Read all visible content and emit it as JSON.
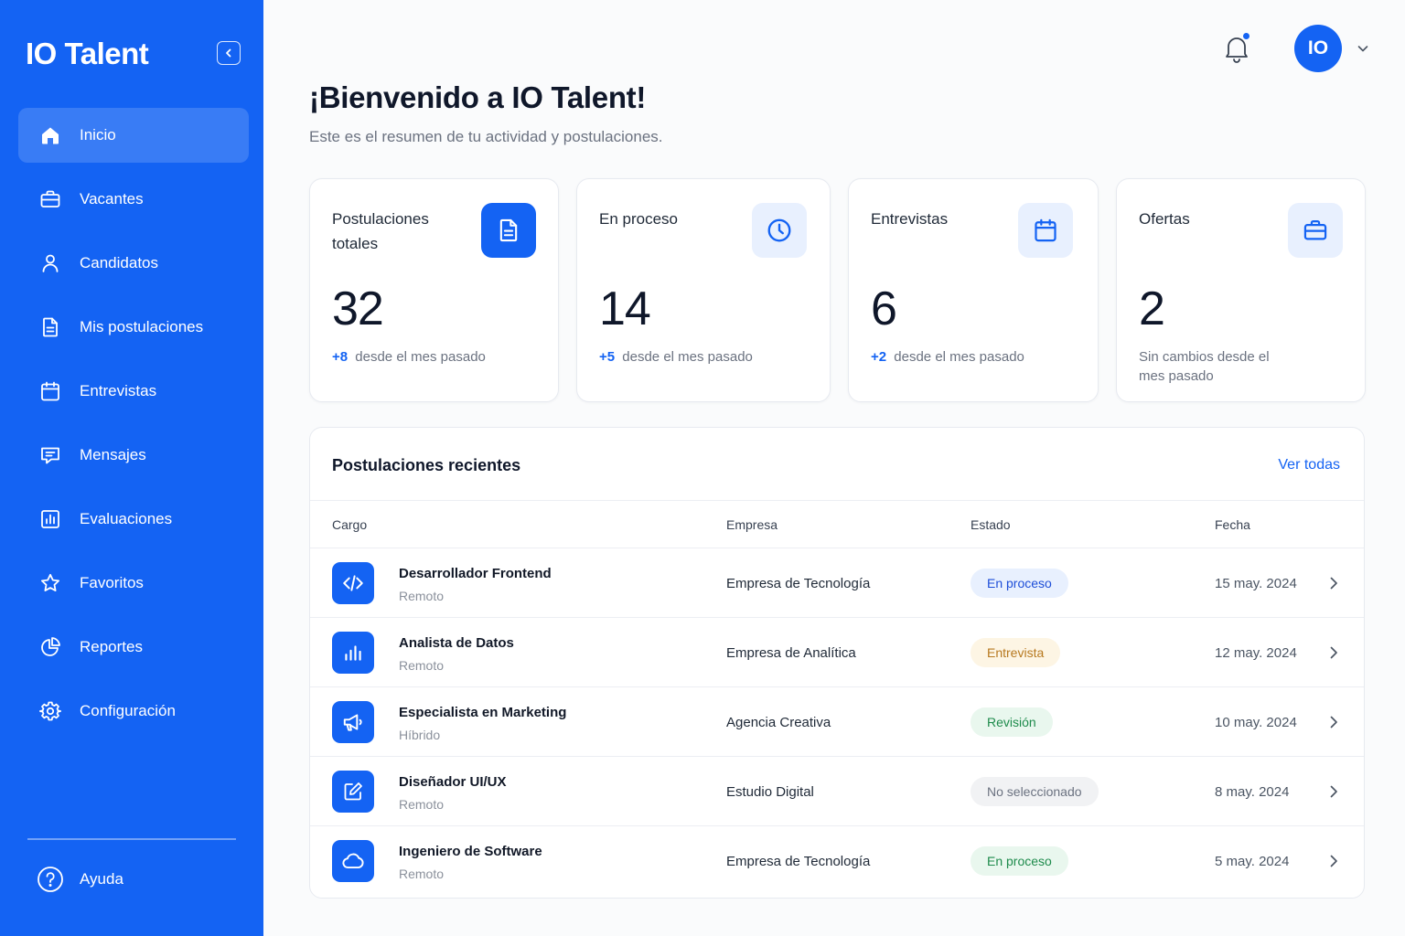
{
  "app": {
    "brand": "IO Talent"
  },
  "sidebar": {
    "items": [
      {
        "label": "Inicio",
        "icon": "home-icon",
        "active": true
      },
      {
        "label": "Vacantes",
        "icon": "briefcase-icon"
      },
      {
        "label": "Candidatos",
        "icon": "user-icon"
      },
      {
        "label": "Mis postulaciones",
        "icon": "document-icon"
      },
      {
        "label": "Entrevistas",
        "icon": "calendar-icon"
      },
      {
        "label": "Mensajes",
        "icon": "message-icon"
      },
      {
        "label": "Evaluaciones",
        "icon": "bar-chart-icon"
      },
      {
        "label": "Favoritos",
        "icon": "star-icon"
      },
      {
        "label": "Reportes",
        "icon": "pie-chart-icon"
      },
      {
        "label": "Configuración",
        "icon": "gear-icon"
      }
    ],
    "help_label": "Ayuda"
  },
  "header": {
    "avatar_initials": "IO",
    "has_notification": true
  },
  "page": {
    "title": "¡Bienvenido a IO Talent!",
    "subtitle": "Este es el resumen de tu actividad y postulaciones."
  },
  "stats": [
    {
      "label": "Postulaciones totales",
      "value": "32",
      "delta": "+8",
      "delta_text": "desde el mes pasado",
      "icon": "document-icon"
    },
    {
      "label": "En proceso",
      "value": "14",
      "delta": "+5",
      "delta_text": "desde el mes pasado",
      "icon": "clock-icon"
    },
    {
      "label": "Entrevistas",
      "value": "6",
      "delta": "+2",
      "delta_text": "desde el mes pasado",
      "icon": "calendar-icon"
    },
    {
      "label": "Ofertas",
      "value": "2",
      "delta": "",
      "delta_text": "Sin cambios desde el mes pasado",
      "icon": "briefcase-icon"
    }
  ],
  "recent": {
    "title": "Postulaciones recientes",
    "see_all": "Ver todas",
    "columns": [
      "Cargo",
      "Empresa",
      "Estado",
      "Fecha"
    ],
    "rows": [
      {
        "title": "Desarrollador Frontend",
        "mode": "Remoto",
        "company": "Empresa de Tecnología",
        "status": "En proceso",
        "status_kind": "blue",
        "date": "15 may. 2024",
        "icon": "code-icon"
      },
      {
        "title": "Analista de Datos",
        "mode": "Remoto",
        "company": "Empresa de Analítica",
        "status": "Entrevista",
        "status_kind": "amber",
        "date": "12 may. 2024",
        "icon": "bar-chart-icon"
      },
      {
        "title": "Especialista en Marketing",
        "mode": "Híbrido",
        "company": "Agencia Creativa",
        "status": "Revisión",
        "status_kind": "green",
        "date": "10 may. 2024",
        "icon": "megaphone-icon"
      },
      {
        "title": "Diseñador UI/UX",
        "mode": "Remoto",
        "company": "Estudio Digital",
        "status": "No seleccionado",
        "status_kind": "gray",
        "date": "8 may. 2024",
        "icon": "pencil-square-icon"
      },
      {
        "title": "Ingeniero de Software",
        "mode": "Remoto",
        "company": "Empresa de Tecnología",
        "status": "En proceso",
        "status_kind": "green",
        "date": "5 may. 2024",
        "icon": "cloud-icon"
      }
    ]
  },
  "colors": {
    "primary": "#1463f3",
    "badge_blue_bg": "#e8f0fe",
    "badge_blue_fg": "#1d4ed8",
    "badge_amber_bg": "#fdf5e4",
    "badge_amber_fg": "#b7791f",
    "badge_green_bg": "#e9f7ee",
    "badge_green_fg": "#1e8b4c",
    "badge_gray_bg": "#f1f2f4",
    "badge_gray_fg": "#6b7280"
  }
}
